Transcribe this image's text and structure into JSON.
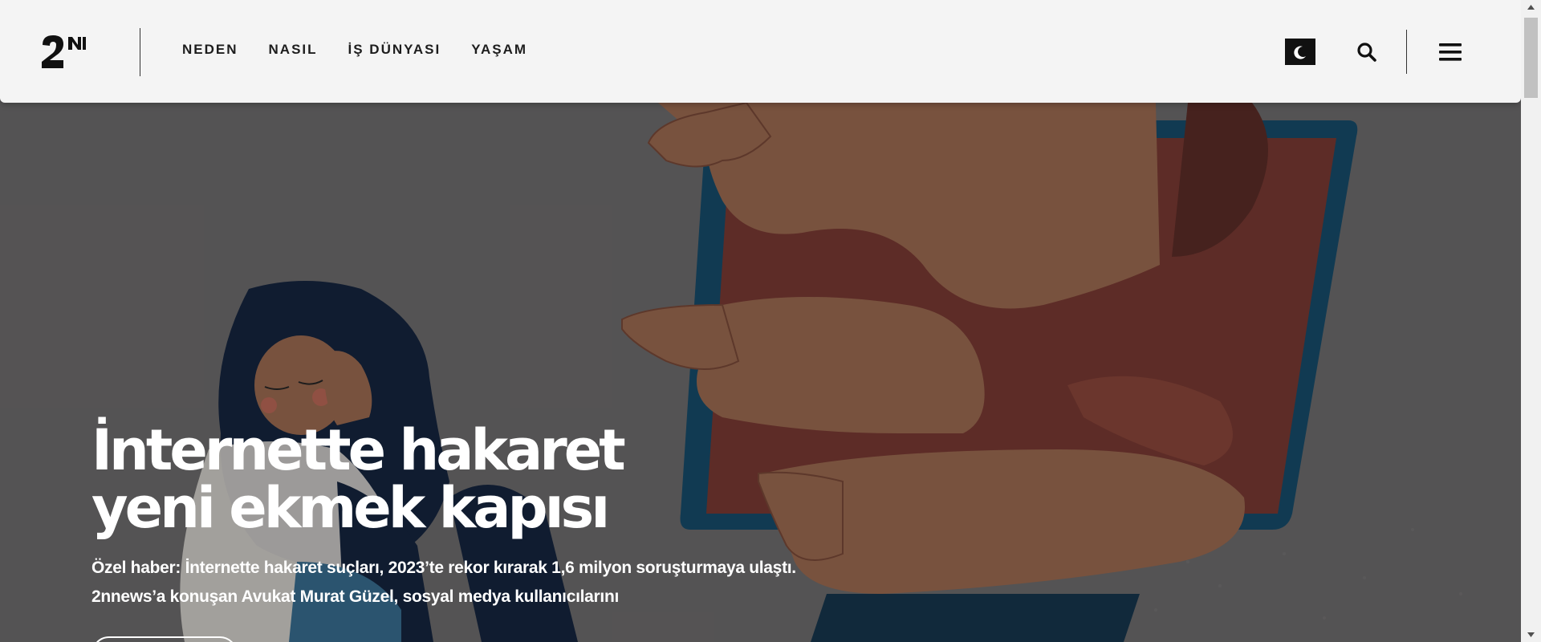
{
  "header": {
    "logo_text": "2N",
    "nav": [
      {
        "label": "NEDEN"
      },
      {
        "label": "NASIL"
      },
      {
        "label": "İŞ DÜNYASI"
      },
      {
        "label": "YAŞAM"
      }
    ],
    "icons": {
      "theme": "moon-icon",
      "search": "search-icon",
      "menu": "hamburger-icon"
    }
  },
  "hero": {
    "title": "İnternette hakaret yeni ekmek kapısı",
    "subtitle_line1": "Özel haber: İnternette hakaret suçları, 2023’te rekor kırarak 1,6 milyon soruşturmaya ulaştı.",
    "subtitle_line2": "2nnews’a konuşan Avukat Murat Güzel, sosyal medya kullanıcılarını"
  },
  "colors": {
    "header_bg": "#f4f4f4",
    "hero_bg": "#5f5d5e",
    "text_dark": "#1d1d1d",
    "accent_screen": "#6a2e28",
    "accent_frame": "#0d3f5c"
  }
}
